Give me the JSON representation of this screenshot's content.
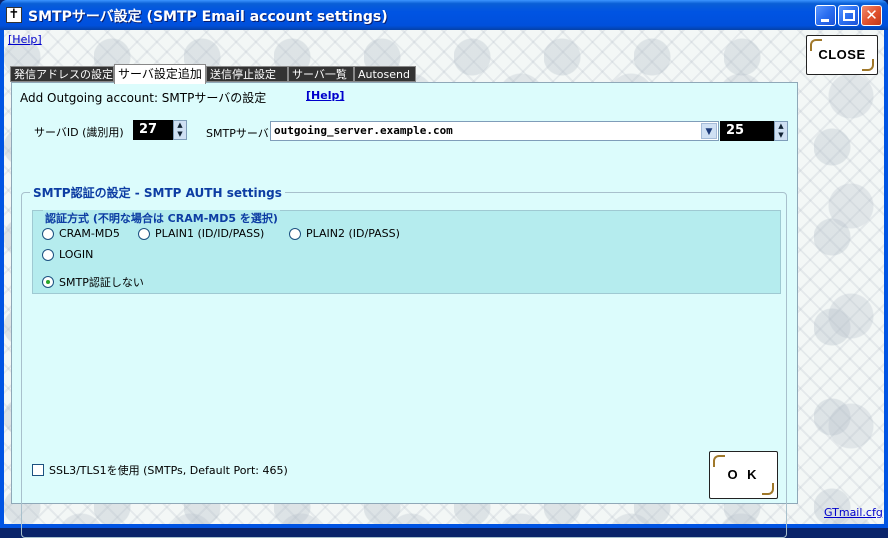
{
  "window": {
    "title": "SMTPサーバ設定 (SMTP Email account settings)",
    "icon": "cross-icon",
    "accent_color": "#0054e3"
  },
  "top": {
    "help": "[Help]",
    "close": "CLOSE"
  },
  "tabs": [
    {
      "label": "発信アドレスの設定",
      "active": false
    },
    {
      "label": "サーバ設定追加",
      "active": true
    },
    {
      "label": "送信停止設定",
      "active": false
    },
    {
      "label": "サーバ一覧",
      "active": false
    },
    {
      "label": "Autosend",
      "active": false
    }
  ],
  "panel": {
    "heading": "Add Outgoing account: SMTPサーバの設定",
    "help": "[Help]",
    "server_id_label": "サーバID (識別用)",
    "server_id_value": "27",
    "server_label": "SMTPサーバ",
    "server_value": "outgoing_server.example.com",
    "port_value": "25",
    "auth_group_title": "SMTP認証の設定 - SMTP AUTH settings",
    "auth_method_title": "認証方式 (不明な場合は CRAM-MD5 を選択)",
    "auth_options": [
      {
        "label": "CRAM-MD5",
        "selected": false
      },
      {
        "label": "PLAIN1 (ID/ID/PASS)",
        "selected": false
      },
      {
        "label": "PLAIN2 (ID/PASS)",
        "selected": false
      },
      {
        "label": "LOGIN",
        "selected": false
      },
      {
        "label": "SMTP認証しない",
        "selected": true
      }
    ],
    "ssl_label": "SSL3/TLS1を使用 (SMTPs, Default Port: 465)",
    "ssl_checked": false,
    "ok": "O K"
  },
  "footer": {
    "cfg_link": "GTmail.cfg"
  }
}
